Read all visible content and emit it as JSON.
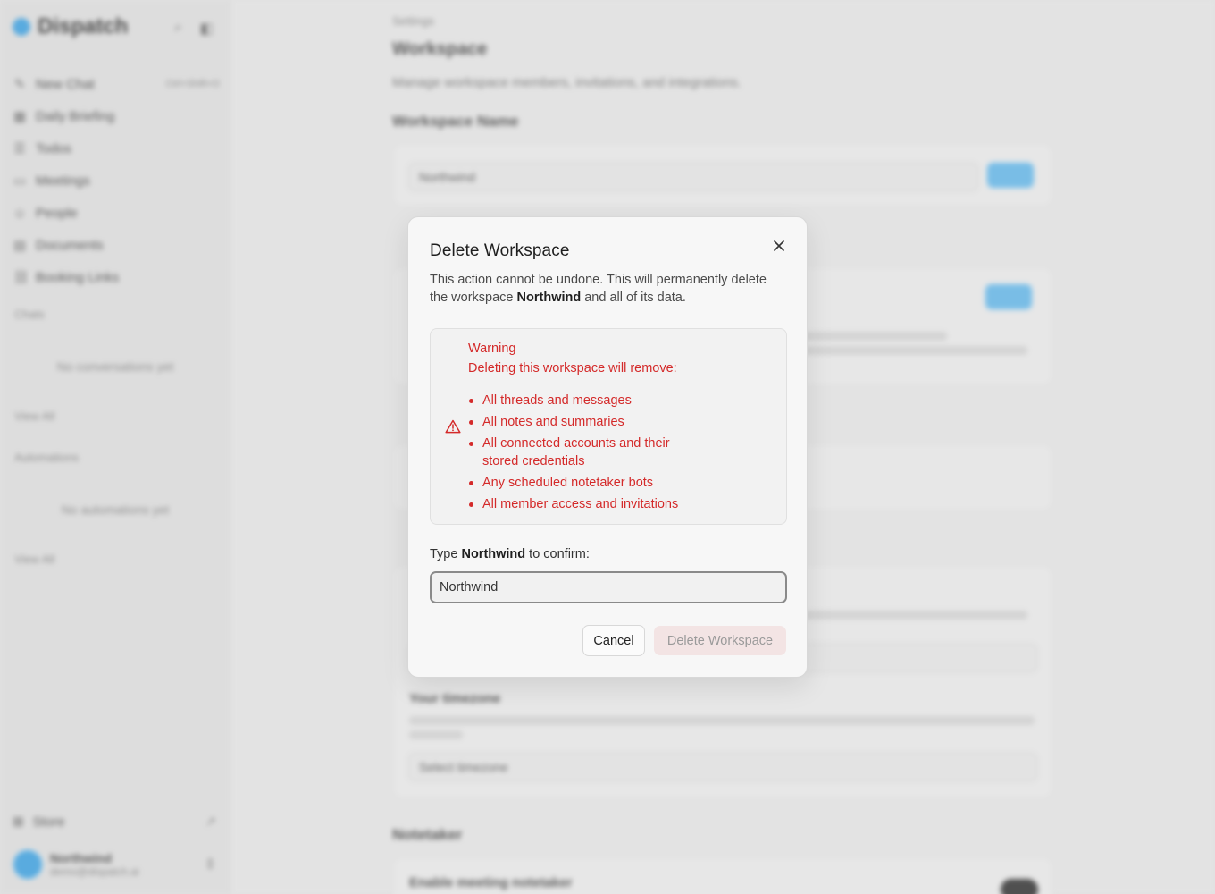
{
  "background": {
    "brand": {
      "name": "Dispatch"
    },
    "nav_items": [
      {
        "label": "New Chat",
        "shortcut": "Ctrl+Shift+O",
        "icon": "compose-icon"
      },
      {
        "label": "Daily Briefing",
        "icon": "briefing-icon"
      },
      {
        "label": "Todos",
        "icon": "checklist-icon"
      },
      {
        "label": "Meetings",
        "icon": "calendar-icon"
      },
      {
        "label": "People",
        "icon": "people-icon"
      },
      {
        "label": "Documents",
        "icon": "document-icon"
      },
      {
        "label": "Booking Links",
        "icon": "link-icon"
      }
    ],
    "chats_heading": "Chats",
    "chats_empty": "No conversations yet",
    "chats_view_all": "View All",
    "automations_heading": "Automations",
    "automations_empty": "No automations yet",
    "automations_view_all": "View All",
    "store_label": "Store",
    "user": {
      "name": "Northwind",
      "email": "demo@dispatch.ai"
    },
    "settings": {
      "breadcrumb": "Settings",
      "title": "Workspace",
      "subtitle": "Manage workspace members, invitations, and integrations.",
      "workspace_name_heading": "Workspace Name",
      "workspace_name_value": "Northwind",
      "timezone_heading": "Your timezone",
      "timezone_placeholder": "Select timezone",
      "notetaker_heading": "Notetaker",
      "notetaker_toggle_label": "Enable meeting notetaker"
    }
  },
  "modal": {
    "title": "Delete Workspace",
    "desc_before": "This action cannot be undone. This will permanently delete the workspace ",
    "desc_workspace": "Northwind",
    "desc_after": " and all of its data.",
    "warning_title": "Warning",
    "warning_lead": "Deleting this workspace will remove:",
    "warning_items": [
      "All threads and messages",
      "All notes and summaries",
      "All connected accounts and their stored credentials",
      "Any scheduled notetaker bots",
      "All member access and invitations"
    ],
    "confirm_prefix": "Type ",
    "confirm_workspace": "Northwind",
    "confirm_suffix": " to confirm:",
    "confirm_value": "Northwind",
    "cancel_label": "Cancel",
    "delete_label": "Delete Workspace",
    "colors": {
      "danger": "#d42a2a",
      "danger_bg": "#f3e4e4",
      "accent": "#2e9be0"
    }
  }
}
